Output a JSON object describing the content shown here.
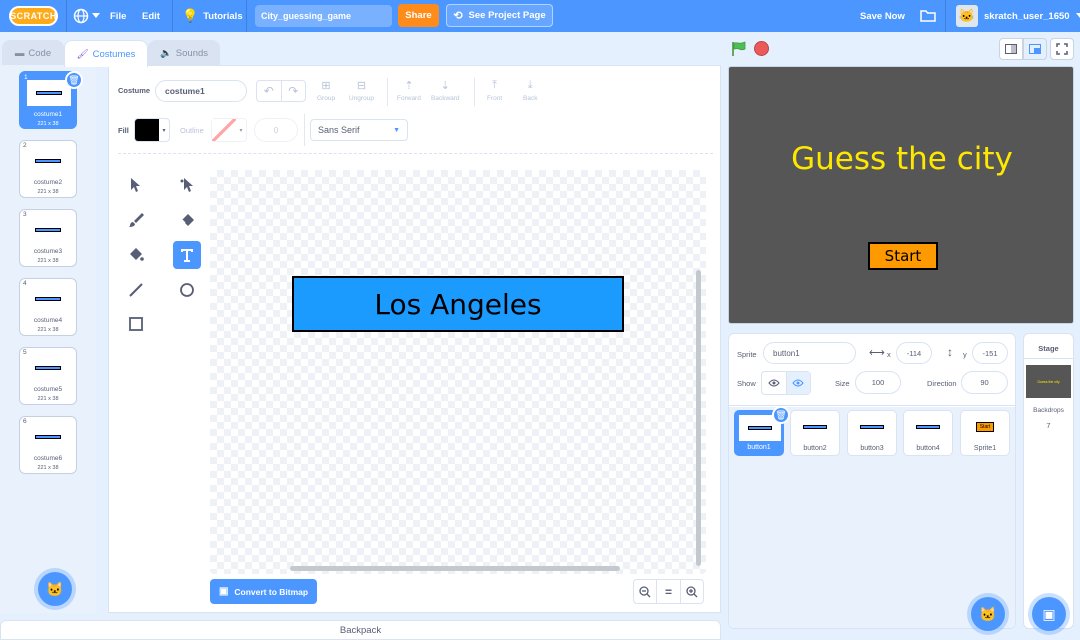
{
  "menu": {
    "logo": "SCRATCH",
    "file": "File",
    "edit": "Edit",
    "tutorials": "Tutorials",
    "project_title": "City_guessing_game",
    "share": "Share",
    "see_project": "See Project Page",
    "save_now": "Save Now",
    "username": "skratch_user_1650"
  },
  "tabs": {
    "code": "Code",
    "costumes": "Costumes",
    "sounds": "Sounds"
  },
  "costumes": [
    {
      "num": "1",
      "name": "costume1",
      "size": "221 x 38"
    },
    {
      "num": "2",
      "name": "costume2",
      "size": "221 x 38"
    },
    {
      "num": "3",
      "name": "costume3",
      "size": "221 x 38"
    },
    {
      "num": "4",
      "name": "costume4",
      "size": "221 x 38"
    },
    {
      "num": "5",
      "name": "costume5",
      "size": "221 x 38"
    },
    {
      "num": "6",
      "name": "costume6",
      "size": "221 x 38"
    }
  ],
  "editor": {
    "costume_label": "Costume",
    "costume_name": "costume1",
    "group": "Group",
    "ungroup": "Ungroup",
    "forward": "Forward",
    "backward": "Backward",
    "front": "Front",
    "back": "Back",
    "fill_label": "Fill",
    "outline_label": "Outline",
    "outline_width": "0",
    "font": "Sans Serif",
    "canvas_text": "Los Angeles",
    "convert_bitmap": "Convert to Bitmap",
    "zoom_reset": "="
  },
  "colors": {
    "fill": "#000000",
    "button_fill": "#1c9bff",
    "accent": "#4c97ff",
    "stage_bg": "#565656",
    "stage_title": "#ffe800",
    "start_button": "#ff9900"
  },
  "stage": {
    "title": "Guess the city",
    "start": "Start"
  },
  "sprite_info": {
    "sprite_label": "Sprite",
    "sprite_name": "button1",
    "x_label": "x",
    "x_value": "-114",
    "y_label": "y",
    "y_value": "-151",
    "show_label": "Show",
    "size_label": "Size",
    "size_value": "100",
    "direction_label": "Direction",
    "direction_value": "90"
  },
  "sprites": [
    {
      "name": "button1"
    },
    {
      "name": "button2"
    },
    {
      "name": "button3"
    },
    {
      "name": "button4"
    },
    {
      "name": "Sprite1",
      "thumb_text": "Start"
    }
  ],
  "stage_panel": {
    "title": "Stage",
    "backdrops_label": "Backdrops",
    "backdrops_count": "7",
    "thumb_text": "Guess the city"
  },
  "backpack": "Backpack"
}
